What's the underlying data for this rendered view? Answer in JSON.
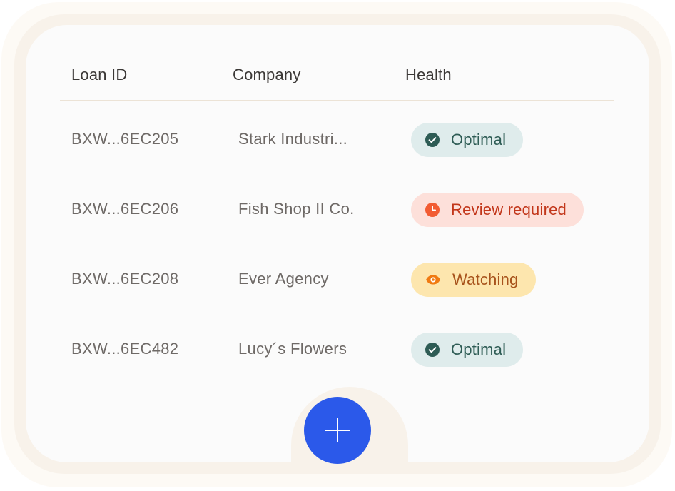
{
  "table": {
    "headers": {
      "loan_id": "Loan ID",
      "company": "Company",
      "health": "Health"
    },
    "rows": [
      {
        "loan_id": "BXW...6EC205",
        "company": "Stark Industri...",
        "health": "Optimal",
        "status": "optimal"
      },
      {
        "loan_id": "BXW...6EC206",
        "company": "Fish Shop II Co.",
        "health": "Review required",
        "status": "review"
      },
      {
        "loan_id": "BXW...6EC208",
        "company": "Ever Agency",
        "health": "Watching",
        "status": "watching"
      },
      {
        "loan_id": "BXW...6EC482",
        "company": "Lucy´s Flowers",
        "health": "Optimal",
        "status": "optimal"
      }
    ]
  },
  "status_styles": {
    "optimal": {
      "icon": "check-circle-icon",
      "bg": "#dfecec",
      "fg": "#2e5c55",
      "icon_color": "#2e5c55"
    },
    "review": {
      "icon": "clock-icon",
      "bg": "#fde0da",
      "fg": "#c2361a",
      "icon_color": "#f25c33"
    },
    "watching": {
      "icon": "eye-icon",
      "bg": "#fde6ae",
      "fg": "#a8531c",
      "icon_color": "#f07a12"
    }
  },
  "fab": {
    "icon": "plus-icon",
    "color": "#2b59ea"
  }
}
